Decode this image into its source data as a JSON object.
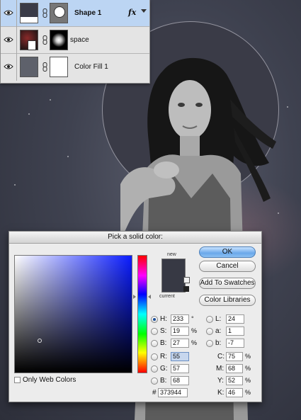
{
  "layers": [
    {
      "name": "Shape 1",
      "selected": true,
      "fx": "fx"
    },
    {
      "name": "space",
      "selected": false
    },
    {
      "name": "Color Fill 1",
      "selected": false
    }
  ],
  "picker": {
    "title": "Pick a solid color:",
    "new_label": "new",
    "current_label": "current",
    "swatch_color": "#373944",
    "buttons": {
      "ok": "OK",
      "cancel": "Cancel",
      "add_swatches": "Add To Swatches",
      "libraries": "Color Libraries"
    },
    "hsb": {
      "h_label": "H:",
      "h": "233",
      "h_unit": "°",
      "s_label": "S:",
      "s": "19",
      "s_unit": "%",
      "b_label": "B:",
      "b": "27",
      "b_unit": "%"
    },
    "lab": {
      "l_label": "L:",
      "l": "24",
      "a_label": "a:",
      "a": "1",
      "b_label": "b:",
      "b": "-7"
    },
    "rgb": {
      "r_label": "R:",
      "r": "55",
      "g_label": "G:",
      "g": "57",
      "b_label": "B:",
      "b": "68"
    },
    "cmyk": {
      "c_label": "C:",
      "c": "75",
      "m_label": "M:",
      "m": "68",
      "y_label": "Y:",
      "y": "52",
      "k_label": "K:",
      "k": "46",
      "unit": "%"
    },
    "hex_label": "#",
    "hex": "373944",
    "web_only": "Only Web Colors"
  }
}
